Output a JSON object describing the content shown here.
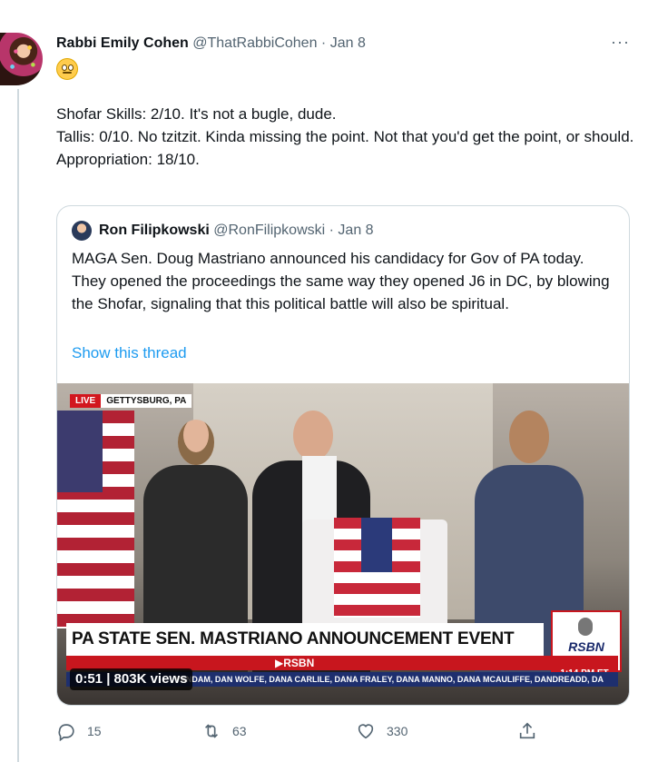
{
  "tweet": {
    "author_name": "Rabbi Emily Cohen",
    "author_handle": "@ThatRabbiCohen",
    "separator": "·",
    "date": "Jan 8",
    "more": "···",
    "lines": [
      "Shofar Skills: 2/10. It's not a bugle, dude.",
      "Tallis: 0/10. No tzitzit. Kinda missing the point. Not that you'd get the point, or should.",
      "Appropriation: 18/10."
    ]
  },
  "quote": {
    "author_name": "Ron Filipkowski",
    "author_handle": "@RonFilipkowski",
    "separator": "·",
    "date": "Jan 8",
    "text": "MAGA Sen. Doug Mastriano announced his candidacy for Gov of PA today. They opened the proceedings the same way they opened J6 in DC, by blowing the Shofar, signaling that this political battle will also be spiritual.",
    "show_thread": "Show this thread"
  },
  "video": {
    "live_label": "LIVE",
    "location": "GETTYSBURG, PA",
    "headline": "PA STATE SEN. MASTRIANO ANNOUNCEMENT EVENT",
    "network": "▶RSBN",
    "logo_text": "RSBN",
    "time": "1:14 PM ET",
    "ticker": "VANDAM, DAN WOLFE, DANA CARLILE, DANA FRALEY, DANA MANNO, DANA MCAULIFFE, DANDREADD, DA",
    "stats": "0:51 | 803K views"
  },
  "actions": {
    "replies": "15",
    "retweets": "63",
    "likes": "330"
  },
  "icons": {
    "reply": "reply-icon",
    "retweet": "retweet-icon",
    "like": "heart-icon",
    "share": "share-icon",
    "emoji": "rolling-eyes-emoji"
  },
  "colors": {
    "link": "#1d9bf0",
    "muted": "#536471",
    "text": "#0f1419",
    "border": "#cfd9de"
  }
}
